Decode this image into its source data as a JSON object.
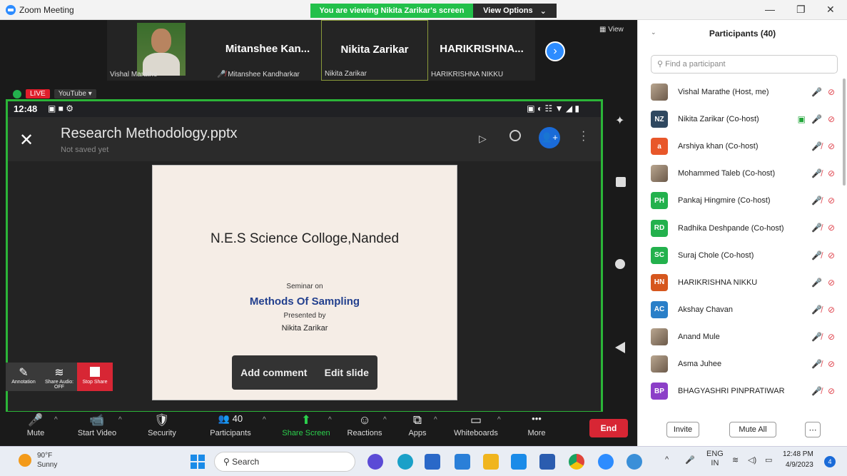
{
  "window": {
    "title": "Zoom Meeting",
    "viewing_banner": "You are viewing Nikita Zarikar's screen",
    "view_options": "View Options"
  },
  "thumbnails": [
    {
      "big": "",
      "small": "Vishal Marathe"
    },
    {
      "big": "Mitanshee  Kan...",
      "small": "Mitanshee Kandharkar"
    },
    {
      "big": "Nikita Zarikar",
      "small": "Nikita Zarikar"
    },
    {
      "big": "HARIKRISHNA...",
      "small": "HARIKRISHNA NIKKU"
    }
  ],
  "view_label": "View",
  "live": {
    "live": "LIVE",
    "platform": "YouTube ▾"
  },
  "phone": {
    "time": "12:48",
    "status_icons": "▣ ■ ⚙",
    "right_icons": "▣ ◐ ☷ ▼ ◢ ▮"
  },
  "document": {
    "name": "Research Methodology.pptx",
    "saved": "Not saved yet",
    "user_badge": "👤+"
  },
  "slide": {
    "college": "N.E.S Science Colloge,Nanded",
    "seminar": "Seminar on",
    "topic": "Methods Of Sampling",
    "presented": "Presented by",
    "author": "Nikita Zarikar"
  },
  "comment_bar": {
    "add": "Add comment",
    "edit": "Edit slide"
  },
  "share_tools": {
    "annotation": "Annotation",
    "share_audio": "Share Audio: OFF",
    "stop": "Stop Share"
  },
  "toolbar": [
    {
      "label": "Mute",
      "icon": "🎤"
    },
    {
      "label": "Start Video",
      "icon": "📹"
    },
    {
      "label": "Security",
      "icon": "🛡"
    },
    {
      "label": "Participants",
      "icon": "👥 40"
    },
    {
      "label": "Share Screen",
      "icon": "⬆"
    },
    {
      "label": "Reactions",
      "icon": "☺"
    },
    {
      "label": "Apps",
      "icon": "⧉"
    },
    {
      "label": "Whiteboards",
      "icon": "▭"
    },
    {
      "label": "More",
      "icon": "•••"
    }
  ],
  "end_label": "End",
  "participants": {
    "title": "Participants (40)",
    "search_placeholder": "Find a participant",
    "list": [
      {
        "initials": "",
        "color": "photo",
        "name": "Vishal Marathe (Host, me)",
        "mic": "on",
        "share": false
      },
      {
        "initials": "NZ",
        "color": "#2f4860",
        "name": "Nikita Zarikar (Co-host)",
        "mic": "on",
        "share": true
      },
      {
        "initials": "a",
        "color": "#e8572a",
        "name": "Arshiya khan (Co-host)",
        "mic": "muted",
        "share": false
      },
      {
        "initials": "",
        "color": "photo",
        "name": "Mohammed Taleb (Co-host)",
        "mic": "muted",
        "share": false
      },
      {
        "initials": "PH",
        "color": "#23b14d",
        "name": "Pankaj Hingmire (Co-host)",
        "mic": "muted",
        "share": false
      },
      {
        "initials": "RD",
        "color": "#23b14d",
        "name": "Radhika Deshpande (Co-host)",
        "mic": "muted",
        "share": false
      },
      {
        "initials": "SC",
        "color": "#23b14d",
        "name": "Suraj Chole (Co-host)",
        "mic": "muted",
        "share": false
      },
      {
        "initials": "HN",
        "color": "#d6571e",
        "name": "HARIKRISHNA NIKKU",
        "mic": "on",
        "share": false
      },
      {
        "initials": "AC",
        "color": "#2a7fc8",
        "name": "Akshay Chavan",
        "mic": "muted",
        "share": false
      },
      {
        "initials": "",
        "color": "photo",
        "name": "Anand Mule",
        "mic": "muted",
        "share": false
      },
      {
        "initials": "",
        "color": "photo",
        "name": "Asma Juhee",
        "mic": "muted",
        "share": false
      },
      {
        "initials": "BP",
        "color": "#8c3fc8",
        "name": "BHAGYASHRI PINPRATIWAR",
        "mic": "muted",
        "share": false
      }
    ],
    "invite": "Invite",
    "mute_all": "Mute All",
    "more": "⋯"
  },
  "taskbar": {
    "temp": "90°F",
    "weather": "Sunny",
    "search": "Search",
    "lang1": "ENG",
    "lang2": "IN",
    "time": "12:48 PM",
    "date": "4/9/2023",
    "notif": "4"
  }
}
